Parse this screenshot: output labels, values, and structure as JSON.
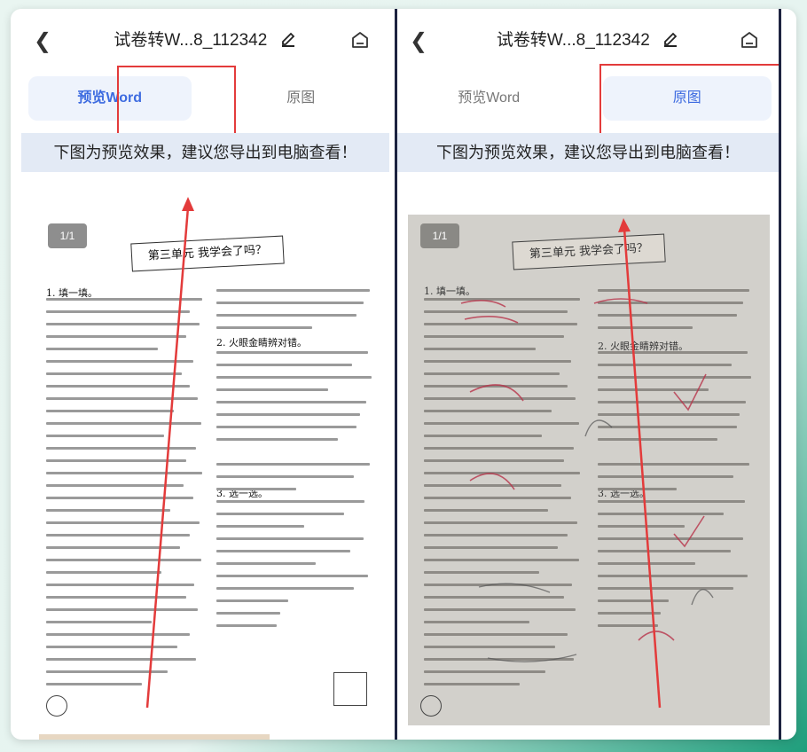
{
  "left": {
    "title": "试卷转W...8_112342",
    "tabs": [
      "预览Word",
      "原图"
    ],
    "active_tab": "预览Word",
    "banner": "下图为预览效果，建议您导出到电脑查看！",
    "page_indicator": "1/1",
    "unit_title": "第三单元  我学会了吗？",
    "sections": [
      "1. 填一填。",
      "2. 火眼金睛辨对错。",
      "3. 选一选。"
    ]
  },
  "right": {
    "title": "试卷转W...8_112342",
    "tabs": [
      "预览Word",
      "原图"
    ],
    "active_tab": "原图",
    "banner": "下图为预览效果，建议您导出到电脑查看！",
    "page_indicator": "1/1",
    "unit_title": "第三单元  我学会了吗？",
    "sections": [
      "1. 填一填。",
      "2. 火眼金睛辨对错。",
      "3. 选一选。"
    ]
  },
  "colors": {
    "accent": "#3d6be0",
    "highlight": "#e33b3b",
    "banner_bg": "#e3eaf5",
    "tab_bg": "#eef3fc"
  },
  "icons": [
    "back-icon",
    "edit-pen-icon",
    "home-icon",
    "arrow-annotation"
  ]
}
